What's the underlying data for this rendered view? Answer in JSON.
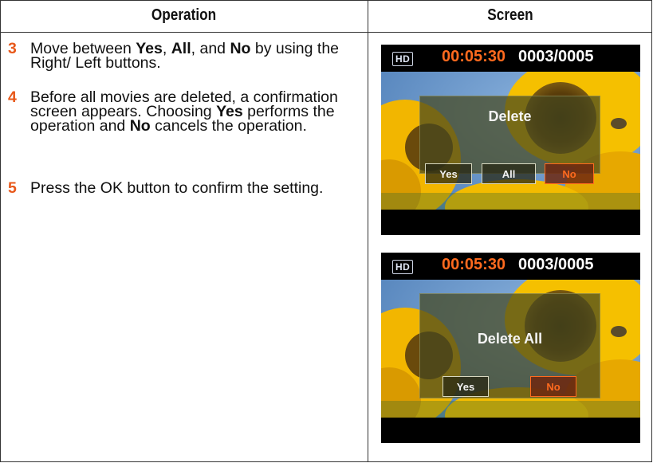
{
  "table": {
    "col_operation": "Operation",
    "col_screen": "Screen"
  },
  "steps": [
    {
      "number": "3",
      "parts": [
        "Move between ",
        "Yes",
        ", ",
        "All",
        ", and ",
        "No",
        " by using the Right/ Left buttons."
      ]
    },
    {
      "number": "4",
      "parts": [
        "Before all movies are deleted, a confirmation screen appears. Choosing ",
        "Yes",
        " performs the operation and ",
        "No",
        " cancels the operation."
      ]
    },
    {
      "number": "5",
      "parts": [
        "Press the OK button to confirm the setting."
      ]
    }
  ],
  "screen1": {
    "hd_badge": "HD",
    "time": "00:05:30",
    "counter": "0003/0005",
    "dialog_title": "Delete",
    "options": [
      "Yes",
      "All",
      "No"
    ],
    "selected": "No"
  },
  "screen2": {
    "hd_badge": "HD",
    "time": "00:05:30",
    "counter": "0003/0005",
    "dialog_title": "Delete All",
    "options": [
      "Yes",
      "No"
    ],
    "selected": "No"
  },
  "colors": {
    "step_number": "#e8581a",
    "time_text": "#ff6a1e",
    "selected_option": "#ff6a1e"
  }
}
